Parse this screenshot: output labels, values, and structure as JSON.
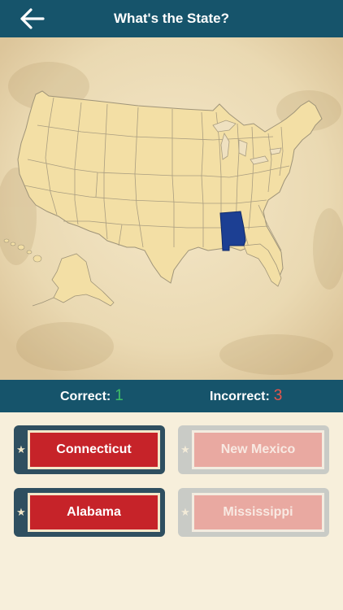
{
  "header": {
    "title": "What's the State?",
    "back_icon": "arrow-left-icon"
  },
  "map": {
    "highlighted_state": "Alabama",
    "highlight_color": "#1c3f93",
    "state_fill": "#f3dfa5",
    "state_stroke": "#b9ab88"
  },
  "score": {
    "correct_label": "Correct:",
    "correct_value": "1",
    "incorrect_label": "Incorrect:",
    "incorrect_value": "3"
  },
  "answers": [
    {
      "label": "Connecticut",
      "state": "active"
    },
    {
      "label": "New Mexico",
      "state": "faded"
    },
    {
      "label": "Alabama",
      "state": "active"
    },
    {
      "label": "Mississippi",
      "state": "faded"
    }
  ],
  "colors": {
    "header_bg": "#16546b",
    "answer_red": "#c62329",
    "correct_green": "#3fbf66",
    "incorrect_red": "#e8554b"
  }
}
